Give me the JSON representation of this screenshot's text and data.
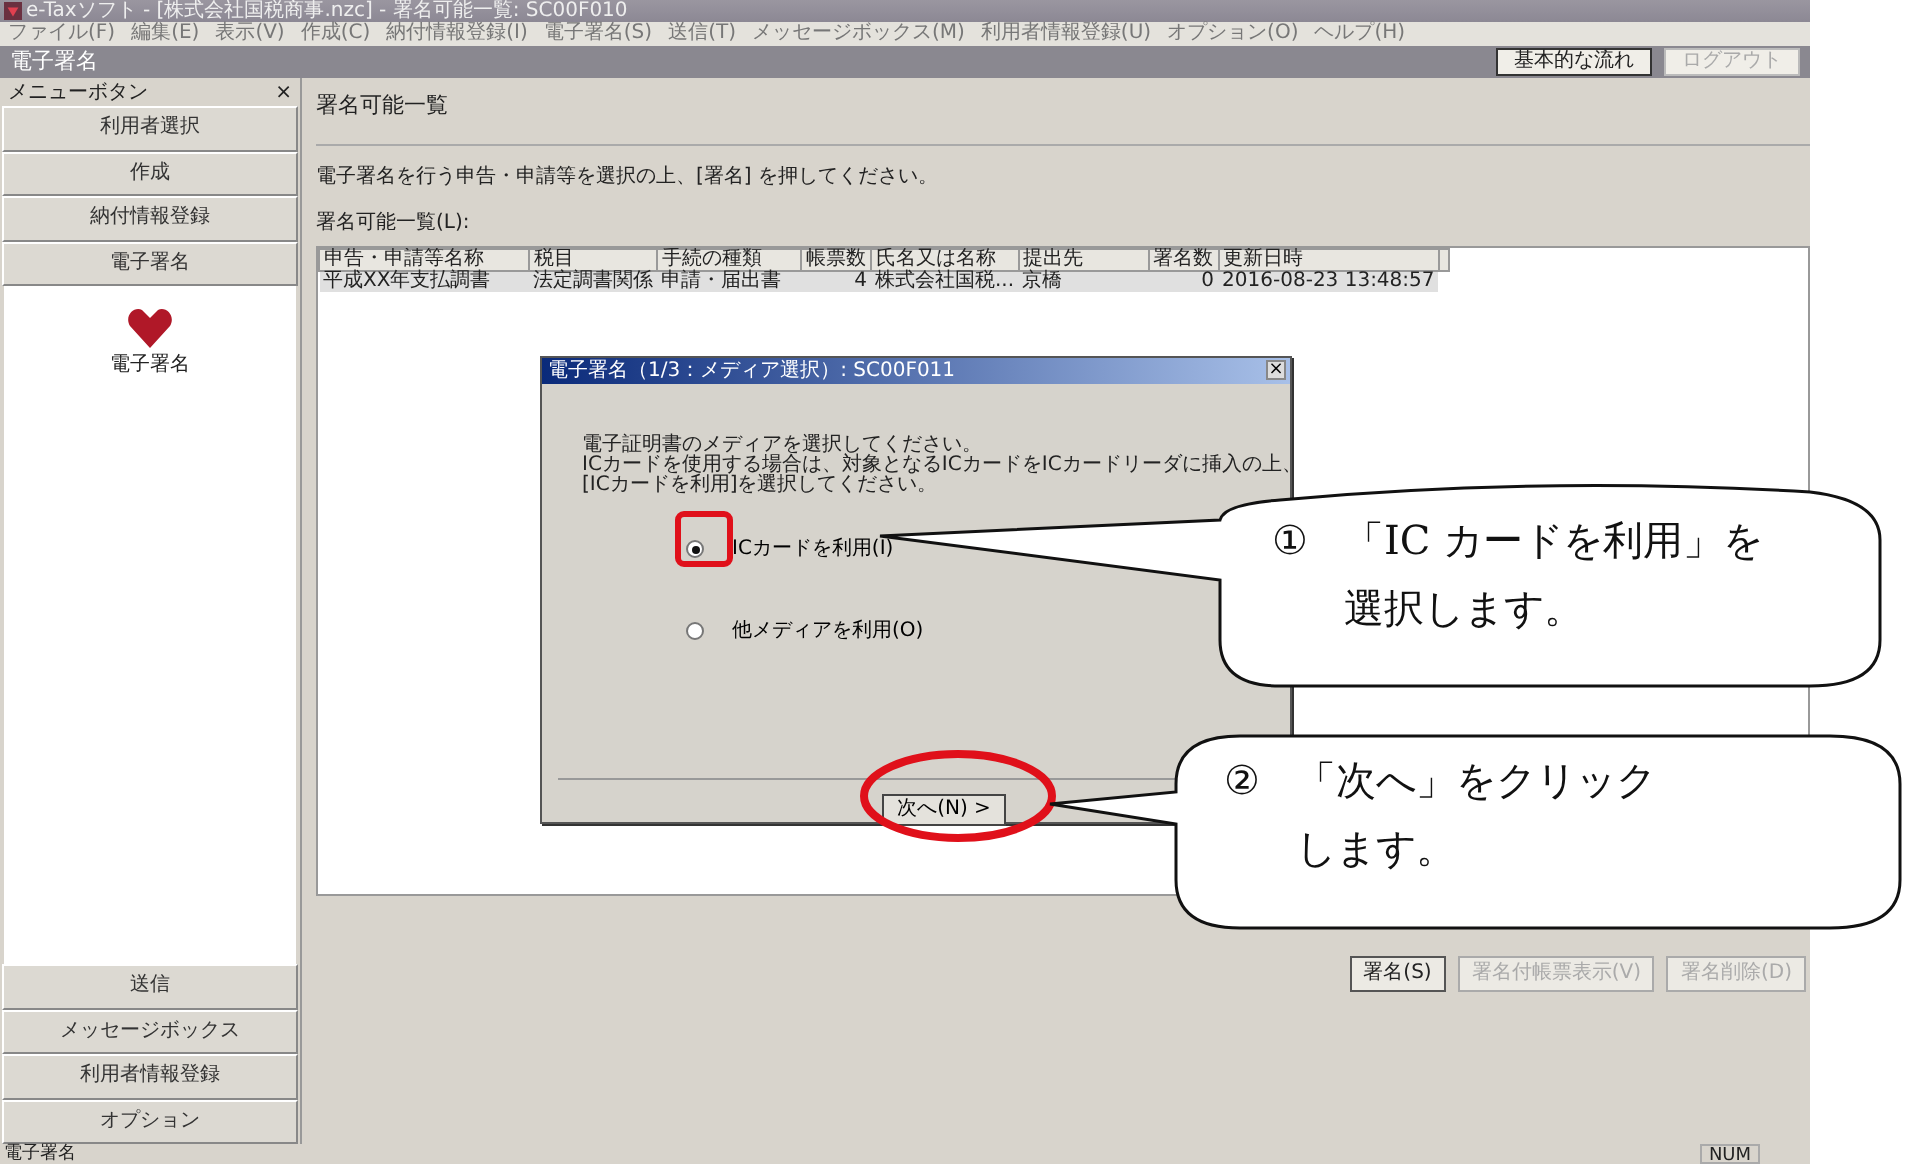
{
  "window": {
    "title": "e-Taxソフト - [株式会社国税商事.nzc] - 署名可能一覧: SC00F010"
  },
  "menu": [
    "ファイル(F)",
    "編集(E)",
    "表示(V)",
    "作成(C)",
    "納付情報登録(I)",
    "電子署名(S)",
    "送信(T)",
    "メッセージボックス(M)",
    "利用者情報登録(U)",
    "オプション(O)",
    "ヘルプ(H)"
  ],
  "header": {
    "title": "電子署名",
    "buttons": [
      {
        "label": "基本的な流れ",
        "disabled": false
      },
      {
        "label": "ログアウト",
        "disabled": true
      }
    ]
  },
  "sidebar": {
    "title": "メニューボタン",
    "close": "×",
    "top_items": [
      "利用者選択",
      "作成",
      "納付情報登録",
      "電子署名"
    ],
    "panel_item": "電子署名",
    "bottom_items": [
      "送信",
      "メッセージボックス",
      "利用者情報登録",
      "オプション"
    ]
  },
  "main": {
    "title": "署名可能一覧",
    "instruction": "電子署名を行う申告・申請等を選択の上、[署名] を押してください。",
    "list_label": "署名可能一覧(L):",
    "table": {
      "columns": [
        "申告・申請等名称",
        "税目",
        "手続の種類",
        "帳票数",
        "氏名又は名称",
        "提出先",
        "署名数",
        "更新日時"
      ],
      "rows": [
        [
          "平成XX年支払調書",
          "法定調書関係",
          "申請・届出書",
          "4",
          "株式会社国税...",
          "京橋",
          "0",
          "2016-08-23 13:48:57"
        ]
      ]
    },
    "buttons": [
      {
        "label": "署名(S)",
        "disabled": false
      },
      {
        "label": "署名付帳票表示(V)",
        "disabled": true
      },
      {
        "label": "署名削除(D)",
        "disabled": true
      }
    ]
  },
  "dialog": {
    "title": "電子署名（1/3：メディア選択）: SC00F011",
    "close": "×",
    "message": [
      "電子証明書のメディアを選択してください。",
      "ICカードを使用する場合は、対象となるICカードをICカードリーダに挿入の上、",
      "[ICカードを利用]を選択してください。"
    ],
    "options": [
      {
        "label": "ICカードを利用(I)",
        "selected": true
      },
      {
        "label": "他メディアを利用(O)",
        "selected": false
      }
    ],
    "next_button": "次へ(N) >"
  },
  "callouts": [
    {
      "number": "①",
      "text": "「IC カードを利用」を選択します。"
    },
    {
      "number": "②",
      "text": "「次へ」をクリックします。"
    }
  ],
  "status_bar": {
    "text": "電子署名",
    "indicator": "NUM"
  }
}
